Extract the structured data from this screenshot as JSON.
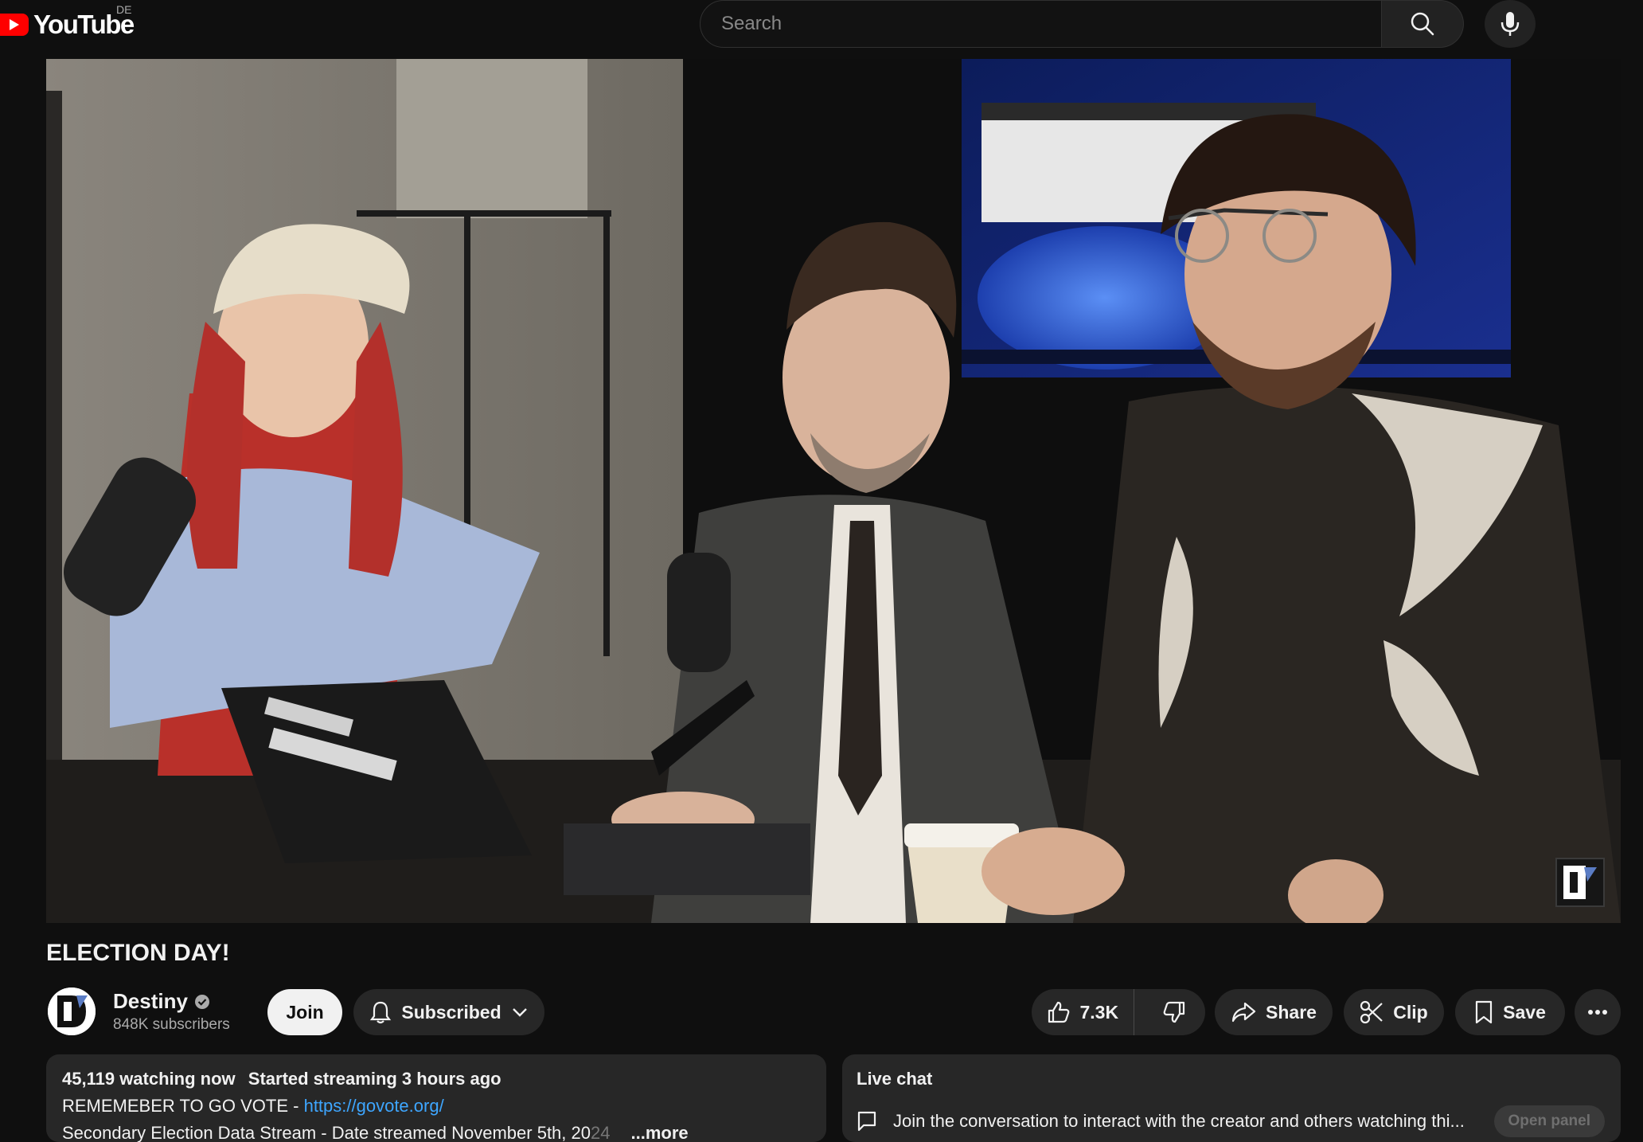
{
  "header": {
    "logo_text": "YouTube",
    "region_code": "DE",
    "search_placeholder": "Search"
  },
  "video": {
    "title": "ELECTION DAY!",
    "watermark_icon": "destiny-logo-icon"
  },
  "channel": {
    "name": "Destiny",
    "subscribers": "848K subscribers",
    "verified_icon": "verified-check-icon"
  },
  "actions": {
    "join_label": "Join",
    "subscribed_label": "Subscribed",
    "like_count": "7.3K",
    "share_label": "Share",
    "clip_label": "Clip",
    "save_label": "Save"
  },
  "description": {
    "watching": "45,119 watching now",
    "started": "Started streaming 3 hours ago",
    "line2_prefix": "REMEMEBER TO GO VOTE - ",
    "line2_link": "https://govote.org/",
    "line3": "Secondary Election Data Stream - Date streamed November 5th, 20",
    "line3_fade": "24",
    "more_label": "...more"
  },
  "livechat": {
    "title": "Live chat",
    "message": "Join the conversation to interact with the creator and others watching thi...",
    "open_panel_label": "Open panel"
  },
  "colors": {
    "background": "#0f0f0f",
    "brand_red": "#ff0000",
    "pill": "#272727",
    "link": "#3ea6ff"
  }
}
